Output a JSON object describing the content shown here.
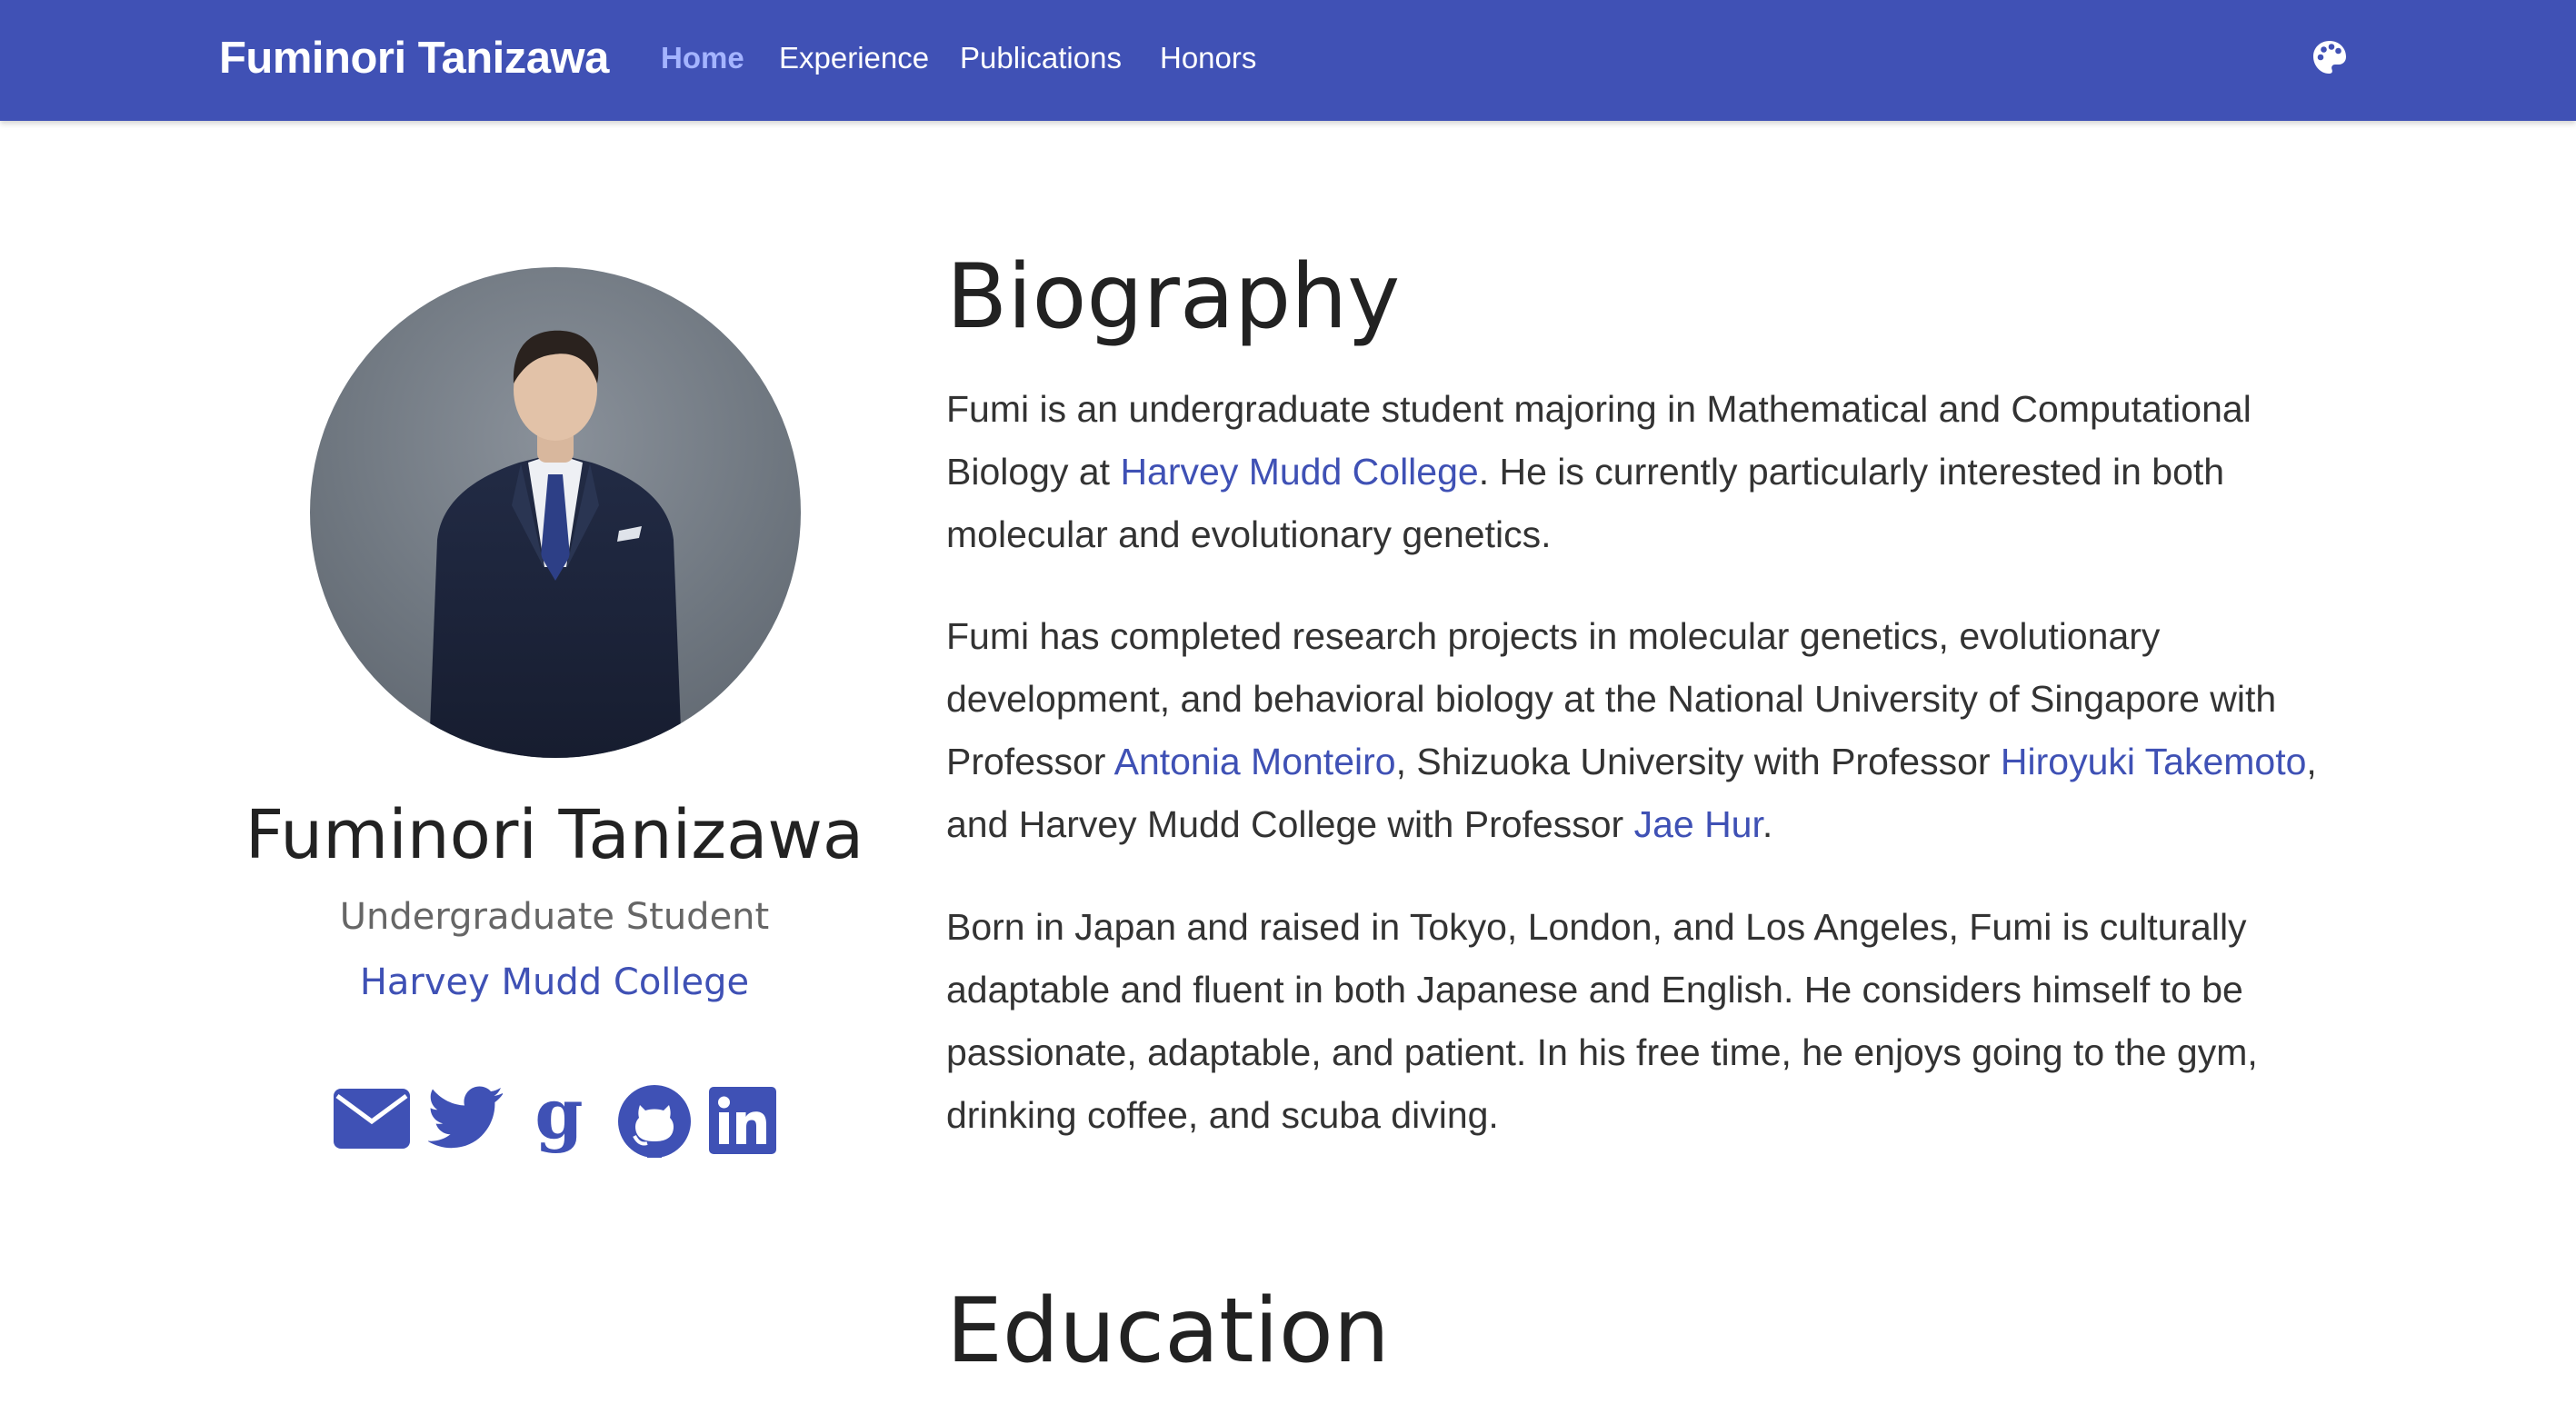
{
  "navbar": {
    "brand": "Fuminori Tanizawa",
    "links": [
      {
        "label": "Home",
        "active": true
      },
      {
        "label": "Experience",
        "active": false
      },
      {
        "label": "Publications",
        "active": false
      },
      {
        "label": "Honors",
        "active": false
      }
    ],
    "theme_icon": "palette-icon"
  },
  "profile": {
    "name": "Fuminori Tanizawa",
    "role": "Undergraduate Student",
    "organization": "Harvey Mudd College",
    "social_icons": [
      "envelope-icon",
      "twitter-icon",
      "google-scholar-icon",
      "github-icon",
      "linkedin-icon"
    ]
  },
  "biography": {
    "heading": "Biography",
    "p1": {
      "t1": "Fumi is an undergraduate student majoring in Mathematical and Computational Biology at ",
      "link1": "Harvey Mudd College",
      "t2": ". He is currently particularly interested in both molecular and evolutionary genetics."
    },
    "p2": {
      "t1": "Fumi has completed research projects in molecular genetics, evolutionary development, and behavioral biology at the National University of Singapore with Professor ",
      "link1": "Antonia Monteiro",
      "t2": ", Shizuoka University with Professor ",
      "link2": "Hiroyuki Takemoto",
      "t3": ", and Harvey Mudd College with Professor ",
      "link3": "Jae Hur",
      "t4": "."
    },
    "p3": "Born in Japan and raised in Tokyo, London, and Los Angeles, Fumi is culturally adaptable and fluent in both Japanese and English. He considers himself to be passionate, adaptable, and patient. In his free time, he enjoys going to the gym, drinking coffee, and scuba diving."
  },
  "education": {
    "heading": "Education"
  },
  "colors": {
    "navbar_bg": "#4051b5",
    "accent": "#3f51b5",
    "active_nav": "#a4b4ff"
  }
}
